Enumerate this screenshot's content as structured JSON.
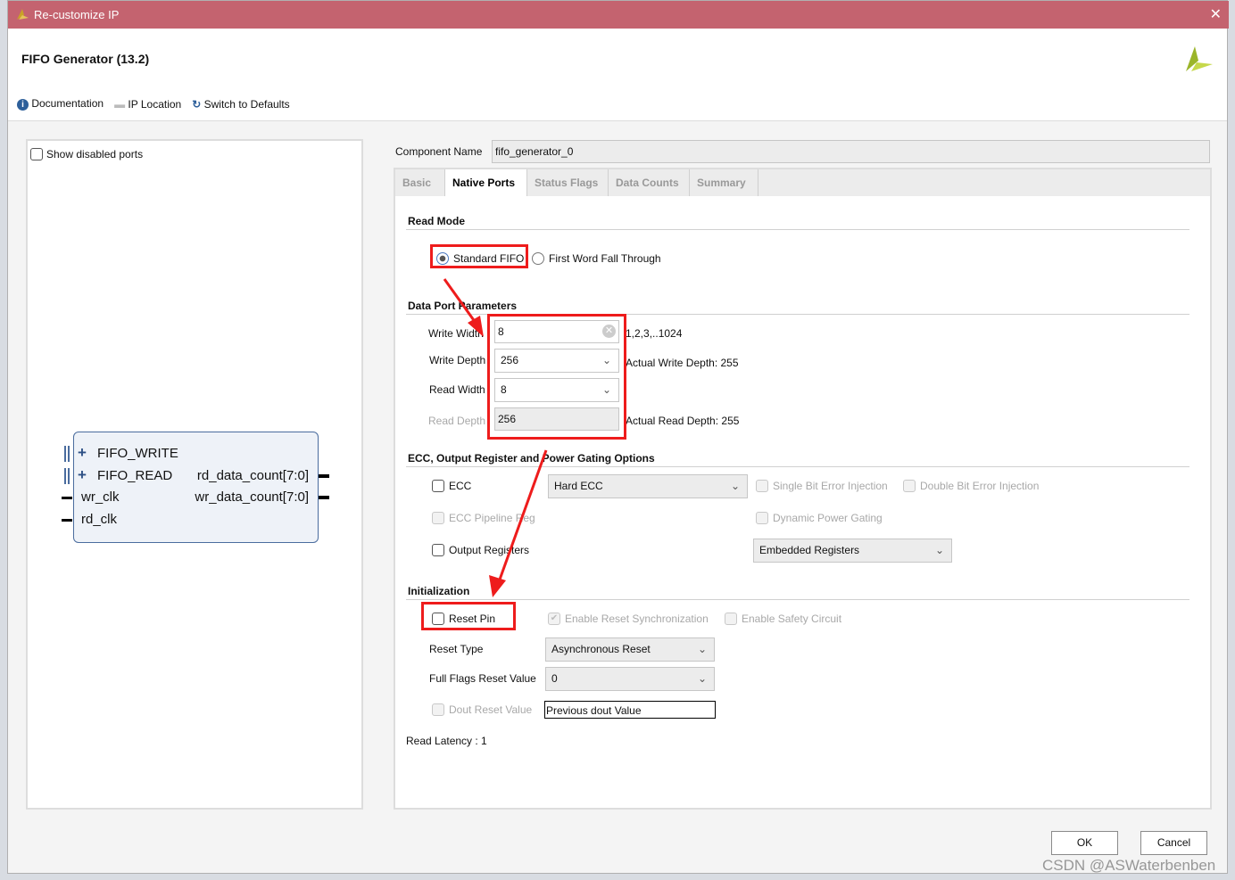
{
  "window": {
    "title": "Re-customize IP",
    "close_icon": "close-icon"
  },
  "header": {
    "title": "FIFO Generator (13.2)"
  },
  "toolbar": {
    "documentation": "Documentation",
    "ip_location": "IP Location",
    "switch_defaults": "Switch to Defaults"
  },
  "left_panel": {
    "show_disabled_ports": "Show disabled ports",
    "symbol": {
      "left_ports": [
        "FIFO_WRITE",
        "FIFO_READ",
        "wr_clk",
        "rd_clk"
      ],
      "right_ports": [
        "rd_data_count[7:0]",
        "wr_data_count[7:0]"
      ]
    }
  },
  "component": {
    "label": "Component Name",
    "value": "fifo_generator_0"
  },
  "tabs": [
    {
      "label": "Basic"
    },
    {
      "label": "Native Ports",
      "active": true
    },
    {
      "label": "Status Flags"
    },
    {
      "label": "Data Counts"
    },
    {
      "label": "Summary"
    }
  ],
  "read_mode": {
    "title": "Read Mode",
    "standard": "Standard FIFO",
    "fwft": "First Word Fall Through",
    "selected": "Standard FIFO"
  },
  "data_port": {
    "title": "Data Port Parameters",
    "write_width_label": "Write Width",
    "write_width": "8",
    "write_width_hint": "1,2,3,..1024",
    "write_depth_label": "Write Depth",
    "write_depth": "256",
    "write_depth_hint": "Actual Write Depth: 255",
    "read_width_label": "Read Width",
    "read_width": "8",
    "read_depth_label": "Read Depth",
    "read_depth": "256",
    "read_depth_hint": "Actual Read Depth: 255"
  },
  "ecc": {
    "title": "ECC, Output Register and Power Gating Options",
    "ecc": "ECC",
    "ecc_type": "Hard ECC",
    "single_bit": "Single Bit Error Injection",
    "double_bit": "Double Bit Error Injection",
    "pipeline": "ECC Pipeline Reg",
    "power_gating": "Dynamic Power Gating",
    "output_regs": "Output Registers",
    "output_reg_type": "Embedded Registers"
  },
  "init": {
    "title": "Initialization",
    "reset_pin": "Reset Pin",
    "enable_sync": "Enable Reset Synchronization",
    "safety": "Enable Safety Circuit",
    "reset_type_label": "Reset Type",
    "reset_type": "Asynchronous Reset",
    "full_flags_label": "Full Flags Reset Value",
    "full_flags": "0",
    "dout_label": "Dout Reset Value",
    "dout_value": "Previous dout Value"
  },
  "read_latency": "Read Latency : 1",
  "footer": {
    "ok": "OK",
    "cancel": "Cancel"
  },
  "watermark": "CSDN @ASWaterbenben",
  "colors": {
    "titlebar": "#c4636f",
    "annotation": "#ee1c1c"
  }
}
